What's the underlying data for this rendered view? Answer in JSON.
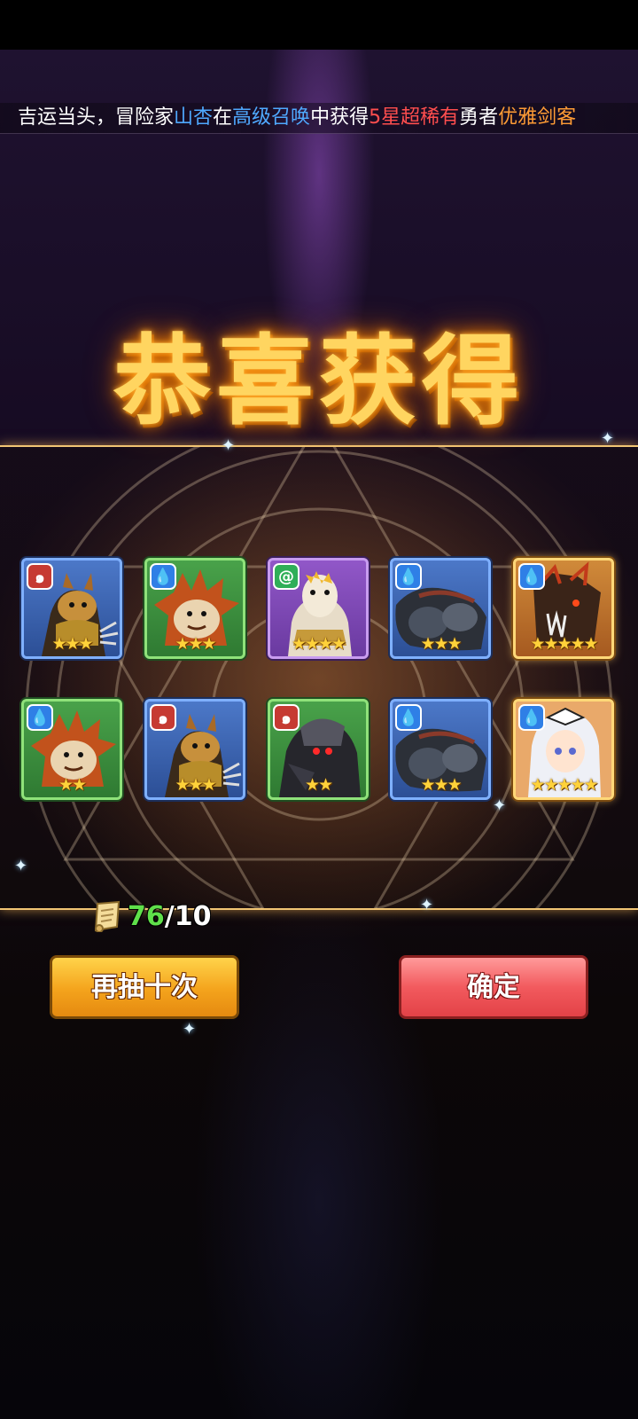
{
  "ticker": {
    "parts": [
      {
        "text": "吉运当头，冒险家",
        "color": "white"
      },
      {
        "text": "山杏",
        "color": "blue"
      },
      {
        "text": "在",
        "color": "white"
      },
      {
        "text": "高级召唤",
        "color": "blue"
      },
      {
        "text": "中获得",
        "color": "white"
      },
      {
        "text": "5星超稀有",
        "color": "red"
      },
      {
        "text": "勇者",
        "color": "white"
      },
      {
        "text": "优雅剑客",
        "color": "orange"
      }
    ]
  },
  "title": "恭喜获得",
  "rewards": [
    {
      "element": "fire",
      "element_icon": "swirl-icon",
      "frame": "blue",
      "stars": "★★★",
      "star_count": 3,
      "creature": "squirrel-warrior"
    },
    {
      "element": "water",
      "element_icon": "water-drop-icon",
      "frame": "green",
      "stars": "★★★",
      "star_count": 3,
      "creature": "spiky-beast"
    },
    {
      "element": "wind",
      "element_icon": "wind-icon",
      "frame": "purple",
      "stars": "★★★★",
      "star_count": 4,
      "creature": "alpaca-king"
    },
    {
      "element": "water",
      "element_icon": "water-drop-icon",
      "frame": "blue",
      "stars": "★★★",
      "star_count": 3,
      "creature": "armored-fist"
    },
    {
      "element": "water",
      "element_icon": "water-drop-icon",
      "frame": "gold",
      "stars": "★★★★★",
      "star_count": 5,
      "creature": "dark-dragon"
    },
    {
      "element": "water",
      "element_icon": "water-drop-icon",
      "frame": "green",
      "stars": "★★",
      "star_count": 2,
      "creature": "spiky-beast"
    },
    {
      "element": "fire",
      "element_icon": "swirl-icon",
      "frame": "blue",
      "stars": "★★★",
      "star_count": 3,
      "creature": "squirrel-warrior"
    },
    {
      "element": "fire",
      "element_icon": "swirl-icon",
      "frame": "green",
      "stars": "★★",
      "star_count": 2,
      "creature": "shadow-knight"
    },
    {
      "element": "water",
      "element_icon": "water-drop-icon",
      "frame": "blue",
      "stars": "★★★",
      "star_count": 3,
      "creature": "armored-fist"
    },
    {
      "element": "water",
      "element_icon": "water-drop-icon",
      "frame": "gold",
      "stars": "★★★★★",
      "star_count": 5,
      "creature": "silver-hair-swordswoman"
    }
  ],
  "scroll": {
    "have": "76",
    "need": "/10"
  },
  "buttons": {
    "again_label": "再抽十次",
    "confirm_label": "确定"
  },
  "colors": {
    "title": "#ffd560",
    "have_count": "#5fe04a",
    "again_button": "#f4a31c",
    "confirm_button": "#f25a5e"
  }
}
